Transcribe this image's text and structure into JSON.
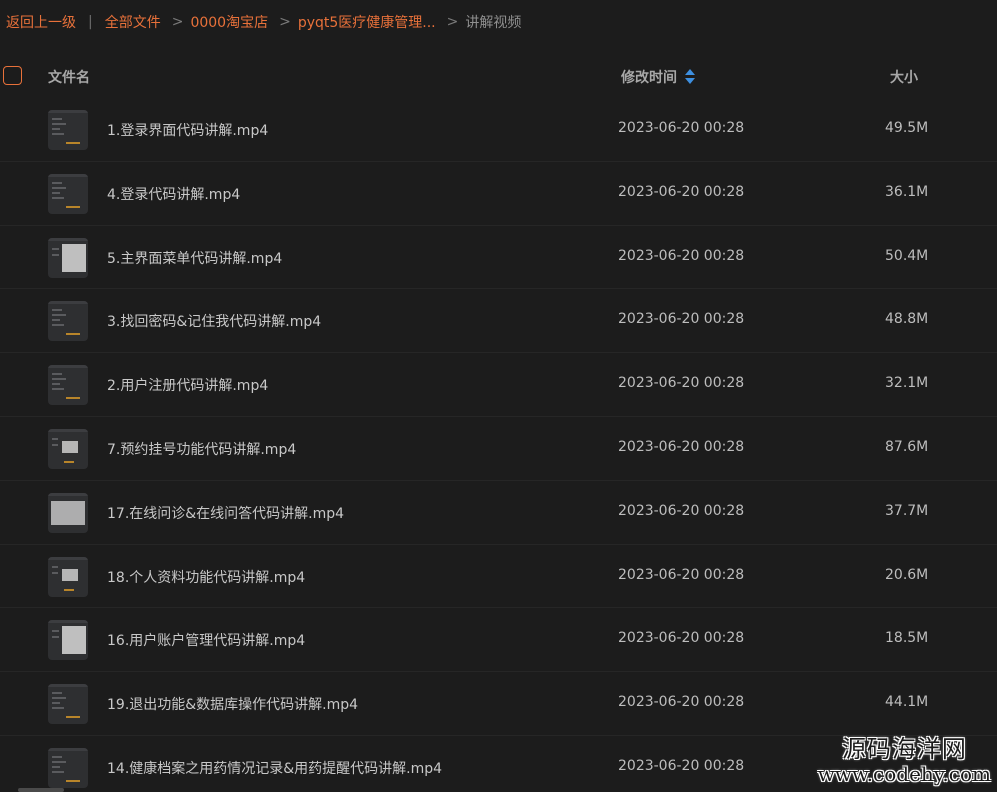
{
  "breadcrumb": {
    "back": "返回上一级",
    "sep_bar": "|",
    "items": [
      "全部文件",
      "0000淘宝店",
      "pyqt5医疗健康管理..."
    ],
    "sep": ">",
    "current": "讲解视频"
  },
  "header": {
    "name": "文件名",
    "time": "修改时间",
    "size": "大小"
  },
  "icons": {
    "sort": "sort-asc-desc-icon",
    "thumbnail": "video-thumbnail-icon"
  },
  "colors": {
    "accent": "#e8713a",
    "sort": "#3d8fe0",
    "background": "#1c1c1c"
  },
  "files": [
    {
      "name": "1.登录界面代码讲解.mp4",
      "date": "2023-06-20 00:28",
      "size": "49.5M",
      "thumb": "dark"
    },
    {
      "name": "4.登录代码讲解.mp4",
      "date": "2023-06-20 00:28",
      "size": "36.1M",
      "thumb": "dark"
    },
    {
      "name": "5.主界面菜单代码讲解.mp4",
      "date": "2023-06-20 00:28",
      "size": "50.4M",
      "thumb": "light"
    },
    {
      "name": "3.找回密码&记住我代码讲解.mp4",
      "date": "2023-06-20 00:28",
      "size": "48.8M",
      "thumb": "dark"
    },
    {
      "name": "2.用户注册代码讲解.mp4",
      "date": "2023-06-20 00:28",
      "size": "32.1M",
      "thumb": "dark"
    },
    {
      "name": "7.预约挂号功能代码讲解.mp4",
      "date": "2023-06-20 00:28",
      "size": "87.6M",
      "thumb": "small-light"
    },
    {
      "name": "17.在线问诊&在线问答代码讲解.mp4",
      "date": "2023-06-20 00:28",
      "size": "37.7M",
      "thumb": "big-light"
    },
    {
      "name": "18.个人资料功能代码讲解.mp4",
      "date": "2023-06-20 00:28",
      "size": "20.6M",
      "thumb": "small-light"
    },
    {
      "name": "16.用户账户管理代码讲解.mp4",
      "date": "2023-06-20 00:28",
      "size": "18.5M",
      "thumb": "light"
    },
    {
      "name": "19.退出功能&数据库操作代码讲解.mp4",
      "date": "2023-06-20 00:28",
      "size": "44.1M",
      "thumb": "dark"
    },
    {
      "name": "14.健康档案之用药情况记录&用药提醒代码讲解.mp4",
      "date": "2023-06-20 00:28",
      "size": "",
      "thumb": "dark"
    }
  ],
  "watermark": {
    "cn": "源码海洋网",
    "url": "www.codehy.com"
  }
}
